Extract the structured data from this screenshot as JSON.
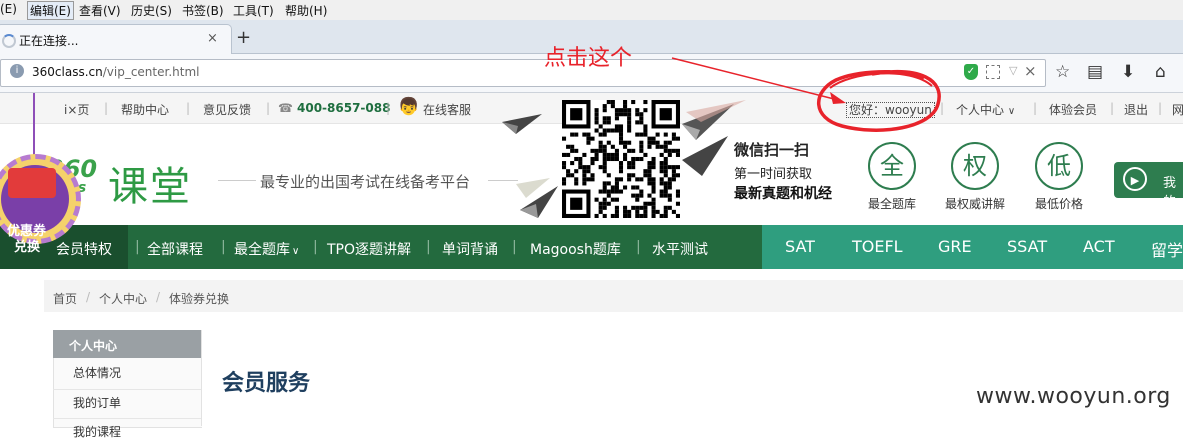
{
  "menubar": {
    "items": [
      {
        "label": "(E)",
        "active": false
      },
      {
        "label": "编辑(E)",
        "active": true
      },
      {
        "label": "查看(V)",
        "active": false
      },
      {
        "label": "历史(S)",
        "active": false
      },
      {
        "label": "书签(B)",
        "active": false
      },
      {
        "label": "工具(T)",
        "active": false
      },
      {
        "label": "帮助(H)",
        "active": false
      }
    ]
  },
  "tabs": {
    "current_title": "正在连接...",
    "close": "×",
    "new_tab": "+"
  },
  "navbar": {
    "url_host": "360class.cn",
    "url_path": "/vip_center.html",
    "clear": "×",
    "dropdown": "▽",
    "star": "☆",
    "reader": "▤",
    "download": "⬇",
    "home": "⌂"
  },
  "topbar": {
    "home": "i×页",
    "help": "帮助中心",
    "feedback": "意见反馈",
    "phone": "400-8657-088",
    "service": "在线客服",
    "greeting": "您好：wooyun",
    "personal": "个人中心",
    "trial": "体验会员",
    "logout": "退出",
    "more": "网"
  },
  "header": {
    "logo_num": "360",
    "logo_en": "class",
    "logo_cn": "课堂",
    "slogan": "最专业的出国考试在线备考平台",
    "wechat_line1": "微信扫一扫",
    "wechat_line2": "第一时间获取",
    "wechat_line3": "最新真题和机经",
    "features": [
      {
        "glyph": "全",
        "label": "最全题库"
      },
      {
        "glyph": "权",
        "label": "最权威讲解"
      },
      {
        "glyph": "低",
        "label": "最低价格"
      }
    ],
    "my_button": "我的"
  },
  "coupon": {
    "line1": "优惠券",
    "line2": "兑换"
  },
  "mainnav": {
    "items": [
      "会员特权",
      "全部课程",
      "最全题库",
      "TPO逐题讲解",
      "单词背诵",
      "Magoosh题库",
      "水平测试"
    ],
    "exams": [
      "SAT",
      "TOEFL",
      "GRE",
      "SSAT",
      "ACT",
      "留学"
    ]
  },
  "breadcrumb": {
    "home": "首页",
    "sep": "/",
    "personal": "个人中心",
    "current": "体验券兑换"
  },
  "sidebar": {
    "title": "个人中心",
    "items": [
      "总体情况",
      "我的订单",
      "我的课程"
    ]
  },
  "content": {
    "title": "会员服务"
  },
  "annotation": {
    "text": "点击这个",
    "color": "#e8232b"
  },
  "watermark": "www.wooyun.org",
  "colors": {
    "nav_green": "#236a3e",
    "exam_teal": "#2f9e7f",
    "brand_green": "#2e9a44"
  }
}
